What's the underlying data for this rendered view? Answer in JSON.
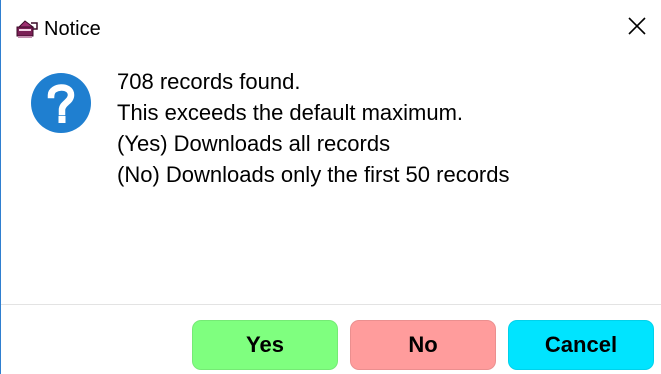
{
  "window": {
    "title": "Notice",
    "title_icon": "notice-app-icon",
    "close_icon": "close-icon",
    "close_glyph": "✕"
  },
  "message": {
    "icon": "question-icon",
    "lines": [
      "708 records found.",
      "This exceeds the default maximum.",
      "(Yes) Downloads all records",
      "(No) Downloads only the first 50 records"
    ]
  },
  "buttons": {
    "yes": {
      "label": "Yes",
      "color": "#7fff7f"
    },
    "no": {
      "label": "No",
      "color": "#ff9c9c"
    },
    "cancel": {
      "label": "Cancel",
      "color": "#00e4ff"
    }
  },
  "colors": {
    "question_icon": "#1f7fd0",
    "window_border": "#2f7fd0"
  }
}
